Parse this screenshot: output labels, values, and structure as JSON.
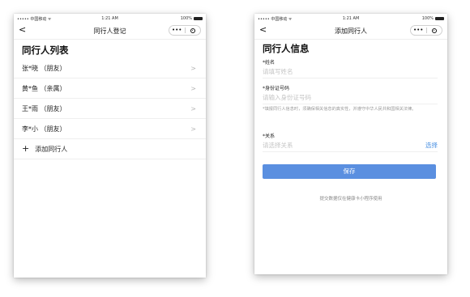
{
  "left": {
    "status": {
      "carrier": "••••• 中国移动 ᯤ",
      "time": "1:21 AM",
      "battery": "100%"
    },
    "nav": {
      "back": "<",
      "title": "同行人登记",
      "more": "•••"
    },
    "section_title": "同行人列表",
    "companions": [
      {
        "name": "张*晓 （朋友）",
        "chevron": ">"
      },
      {
        "name": "黄*鱼 （亲属）",
        "chevron": ">"
      },
      {
        "name": "王*雨 （朋友）",
        "chevron": ">"
      },
      {
        "name": "李*小 （朋友）",
        "chevron": ">"
      }
    ],
    "add": {
      "icon": "+",
      "label": "添加同行人"
    }
  },
  "right": {
    "status": {
      "carrier": "••••• 中国移动 ᯤ",
      "time": "1:21 AM",
      "battery": "100%"
    },
    "nav": {
      "back": "<",
      "title": "添加同行人",
      "more": "•••"
    },
    "section_title": "同行人信息",
    "name_field": {
      "label": "*姓名",
      "placeholder": "请填写姓名"
    },
    "id_field": {
      "label": "*身份证号码",
      "placeholder": "请输入身份证号码"
    },
    "notice": "*填报同行人信息时，须确保相关信息的真实性，并遵守中华人民共和国相关法律。",
    "relation_field": {
      "label": "*关系",
      "placeholder": "请选择关系",
      "action": "选择"
    },
    "save_label": "保存",
    "footnote": "提交数据仅在健康卡小程序使用"
  }
}
